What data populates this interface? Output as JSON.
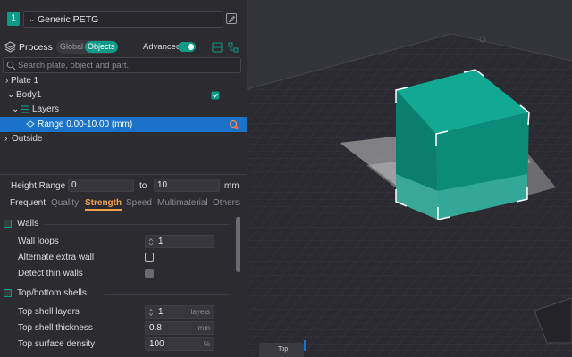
{
  "filament": {
    "index": "1",
    "name": "Generic PETG"
  },
  "process": {
    "label": "Process",
    "scope_global": "Global",
    "scope_objects": "Objects",
    "advanced_label": "Advanced",
    "advanced_on": true
  },
  "search": {
    "placeholder": "Search plate, object and part."
  },
  "tree": {
    "plate": "Plate 1",
    "body": "Body1",
    "layers": "Layers",
    "range": "Range 0.00-10.00 (mm)",
    "outside": "Outside"
  },
  "height_range": {
    "label": "Height Range",
    "from": "0",
    "to_label": "to",
    "to": "10",
    "unit": "mm"
  },
  "tabs": [
    "Frequent",
    "Quality",
    "Strength",
    "Speed",
    "Multimaterial",
    "Others"
  ],
  "active_tab": "Strength",
  "walls": {
    "title": "Walls",
    "wall_loops_label": "Wall loops",
    "wall_loops_value": "1",
    "alternate_extra_wall_label": "Alternate extra wall",
    "detect_thin_walls_label": "Detect thin walls"
  },
  "shells": {
    "title": "Top/bottom shells",
    "top_shell_layers_label": "Top shell layers",
    "top_shell_layers_value": "1",
    "top_shell_layers_unit": "layers",
    "top_shell_thickness_label": "Top shell thickness",
    "top_shell_thickness_value": "0.8",
    "top_shell_thickness_unit": "mm",
    "top_surface_density_label": "Top surface density",
    "top_surface_density_value": "100",
    "top_surface_density_unit": "%"
  },
  "viewport": {
    "view_button": "Top"
  },
  "colors": {
    "accent": "#0e9a86",
    "selection": "#1a73c9",
    "active_tab": "#f0a24a",
    "model": "#0b7e6e"
  }
}
